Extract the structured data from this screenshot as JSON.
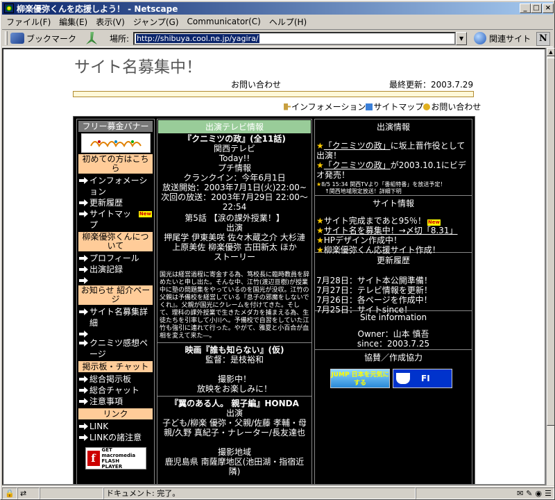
{
  "window": {
    "title": "柳楽優弥くんを応援しよう！ - Netscape"
  },
  "menu": [
    "ファイル(F)",
    "編集(E)",
    "表示(V)",
    "ジャンプ(G)",
    "Communicator(C)",
    "ヘルプ(H)"
  ],
  "toolbar": {
    "bookmarks": "ブックマーク",
    "location_label": "場所:",
    "url": "http://shibuya.cool.ne.jp/yagira/",
    "related": "関連サイト"
  },
  "status": {
    "text": "ドキュメント: 完了。"
  },
  "page": {
    "title": "サイト名募集中！",
    "contact": "お問い合わせ",
    "last_updated": "最終更新：2003.7.29",
    "topnav": [
      "インフォメーション",
      "サイトマップ",
      "お問い合わせ"
    ]
  },
  "left": {
    "banner_head": "フリー募金バナー",
    "sections": [
      {
        "head": "初めての方はこちら",
        "items": [
          {
            "label": "インフォメーション",
            "new": false
          },
          {
            "label": "更新履歴",
            "new": false
          },
          {
            "label": "サイトマップ",
            "new": true
          }
        ]
      },
      {
        "head": "柳楽優弥くんについて",
        "items": [
          {
            "label": "プロフィール",
            "new": false
          },
          {
            "label": "出演記録",
            "new": false
          },
          {
            "label": "",
            "new": false
          }
        ]
      },
      {
        "head": "お知らせ 紹介ページ",
        "items": [
          {
            "label": "サイト名募集詳細",
            "new": false
          },
          {
            "label": "",
            "new": false
          },
          {
            "label": "クニミツ感想ページ",
            "new": false
          }
        ]
      },
      {
        "head": "掲示板・チャット",
        "items": [
          {
            "label": "総合掲示板",
            "new": false
          },
          {
            "label": "総合チャット",
            "new": false
          },
          {
            "label": "注意事項",
            "new": false
          }
        ]
      },
      {
        "head": "リンク",
        "items": [
          {
            "label": "LINK",
            "new": false
          },
          {
            "label": "LINKの諸注意",
            "new": false
          }
        ]
      }
    ],
    "new_badge": "New",
    "flash_text": [
      "GET",
      "macromedia",
      "FLASH",
      "PLAYER"
    ]
  },
  "middle": {
    "head": "出演テレビ情報",
    "show1": {
      "title": "『クニミツの政』(全11話)",
      "lines": [
        "関西テレビ",
        "Today!!",
        "プチ情報",
        "クランクイン：今年6月1日",
        "放送開始：2003年7月1日(火)22:00~",
        "次回の放送：2003年7月29日 22:00～22:54",
        "第5話 【涙の課外授業！】",
        "出演",
        "押尾学 伊東美咲 佐々木蔵之介 大杉漣 上原美佐 柳楽優弥 古田新太 ほか",
        "ストーリー"
      ],
      "story": "国光は経営過程に寄金する為、笃校長に臨時教員を辞めたいと申し出た。そんな中、江竹(渡辺亘樹)が授業中に塾の問題集をやっているのを国光が没収。江竹の父親は予備校を経営している『息子の邪魔をしないでくれ』。父親が国光にクレームを付けてきた。そして、理科の課外授業で生きたメダカを捕まえる為、生徒たちを引率して小川へ。予備校で自習をしていた江竹も強引に連れて行った。やがて、雅夏と小百合が血相を変えて来た―。"
    },
    "show2": {
      "title": "映画『誰も知らない』(仮)",
      "lines": [
        "監督：是枝裕和",
        "",
        "撮影中！",
        "放映をお楽しみに！"
      ]
    },
    "show3": {
      "title": "『翼のある人。 親子編』HONDA",
      "lines": [
        "出演",
        "子ども/柳楽 優弥・父親/佐藤 孝輔・母親/久野 真紀子・ナレーター/長友達也",
        "",
        "撮影地域",
        "鹿児島県 南薩摩地区(池田湖・指宿近隣)"
      ]
    }
  },
  "right": {
    "appear_head": "出演情報",
    "appear": [
      {
        "link": "「クニミツの政」",
        "text": "に坂上晋作役として出演！"
      },
      {
        "link": "「クニミツの政」",
        "text": "が2003.10.1にビデオ発売！"
      }
    ],
    "appear_small": [
      "8/5 15:34 関西TVより「番組特番」を放送予定！",
      "↑関西地域限定放送！詳細下明"
    ],
    "site_head": "サイト情報",
    "site": [
      "サイト完成まであと95％！",
      "サイト名を募集中！→〆切「8.31」",
      "HPデザイン作成中！",
      "柳楽優弥くん応援サイト作成！"
    ],
    "hist_head": "更新履歴",
    "hist": [
      "7月28日：サイト本公開準備！",
      "7月27日：テレビ情報を更新！",
      "7月26日：各ページを作成中！",
      "7月25日：サイトsince！"
    ],
    "info_head": "Site information",
    "info": [
      "Owner：山本 慎吾",
      "since：2003.7.25"
    ],
    "coop_head": "協賛／作成協力",
    "jump": "JUMP 日本を元気にする",
    "fi": "FI"
  }
}
